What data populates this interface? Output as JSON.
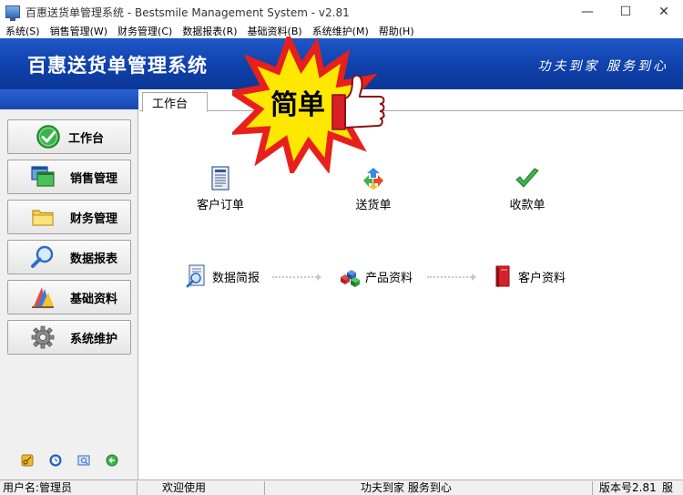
{
  "window": {
    "title": "百惠送货单管理系统 - Bestsmile Management System - v2.81",
    "minimize_glyph": "—",
    "maximize_glyph": "☐",
    "close_glyph": "✕"
  },
  "menu": [
    {
      "label": "系统(S)"
    },
    {
      "label": "销售管理(W)"
    },
    {
      "label": "财务管理(C)"
    },
    {
      "label": "数据报表(R)"
    },
    {
      "label": "基础资料(B)"
    },
    {
      "label": "系统维护(M)"
    },
    {
      "label": "帮助(H)"
    }
  ],
  "banner": {
    "title": "百惠送货单管理系统",
    "slogan": "功夫到家 服务到心",
    "promo": "简单"
  },
  "sidebar": {
    "items": [
      {
        "label": "工作台",
        "icon": "check-circle-icon"
      },
      {
        "label": "销售管理",
        "icon": "windows-icon"
      },
      {
        "label": "财务管理",
        "icon": "folder-icon"
      },
      {
        "label": "数据报表",
        "icon": "magnifier-icon"
      },
      {
        "label": "基础资料",
        "icon": "color-palette-icon"
      },
      {
        "label": "系统维护",
        "icon": "gear-icon"
      }
    ]
  },
  "tabs": [
    {
      "label": "工作台"
    }
  ],
  "workflow": [
    {
      "label": "客户订单",
      "icon": "order-document-icon"
    },
    {
      "label": "送货单",
      "icon": "recycle-arrows-icon"
    },
    {
      "label": "收款单",
      "icon": "green-check-icon"
    }
  ],
  "quick": [
    {
      "label": "数据简报",
      "icon": "report-magnifier-icon"
    },
    {
      "label": "产品资料",
      "icon": "cubes-icon"
    },
    {
      "label": "客户资料",
      "icon": "red-book-icon"
    }
  ],
  "status": {
    "user": "用户名:管理员",
    "welcome": "欢迎使用",
    "slogan": "功夫到家 服务到心",
    "version": "版本号2.81",
    "extra": "服"
  },
  "colors": {
    "banner_blue": "#1447b0",
    "promo_yellow": "#ffe800",
    "promo_red": "#e8201c"
  }
}
